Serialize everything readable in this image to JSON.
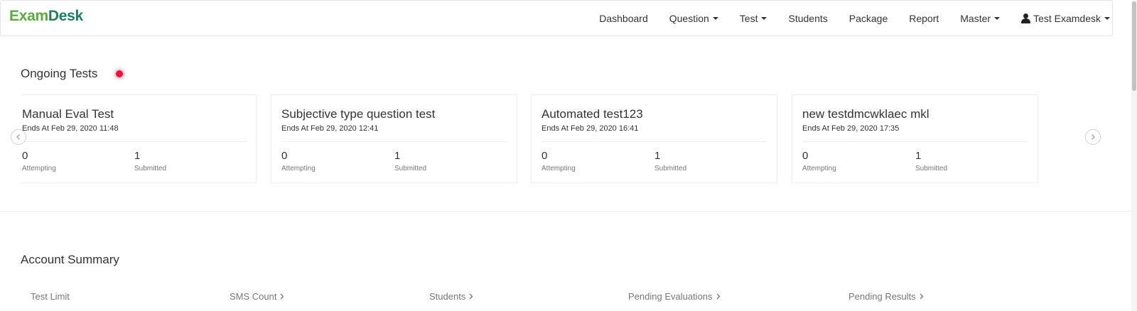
{
  "app": {
    "logo_exam": "Exam",
    "logo_desk": "Desk"
  },
  "nav": {
    "items": [
      {
        "label": "Dashboard",
        "dropdown": false
      },
      {
        "label": "Question",
        "dropdown": true
      },
      {
        "label": "Test",
        "dropdown": true
      },
      {
        "label": "Students",
        "dropdown": false
      },
      {
        "label": "Package",
        "dropdown": false
      },
      {
        "label": "Report",
        "dropdown": false
      },
      {
        "label": "Master",
        "dropdown": true
      }
    ],
    "user_label": "Test Examdesk"
  },
  "ongoing": {
    "title": "Ongoing Tests",
    "live_color": "#e8173d",
    "tests": [
      {
        "name": "Manual Eval Test",
        "ends": "Ends At Feb 29, 2020 11:48",
        "attempting": "0",
        "attempting_label": "Attempting",
        "submitted": "1",
        "submitted_label": "Submitted"
      },
      {
        "name": "Subjective type question test",
        "ends": "Ends At Feb 29, 2020 12:41",
        "attempting": "0",
        "attempting_label": "Attempting",
        "submitted": "1",
        "submitted_label": "Submitted"
      },
      {
        "name": "Automated test123",
        "ends": "Ends At Feb 29, 2020 16:41",
        "attempting": "0",
        "attempting_label": "Attempting",
        "submitted": "1",
        "submitted_label": "Submitted"
      },
      {
        "name": "new testdmcwklaec mkl",
        "ends": "Ends At Feb 29, 2020 17:35",
        "attempting": "0",
        "attempting_label": "Attempting",
        "submitted": "1",
        "submitted_label": "Submitted"
      }
    ]
  },
  "account": {
    "title": "Account Summary",
    "items": [
      {
        "label": "Test Limit",
        "link": false
      },
      {
        "label": "SMS Count",
        "link": true
      },
      {
        "label": "Students",
        "link": true
      },
      {
        "label": "Pending Evaluations",
        "link": true
      },
      {
        "label": "Pending Results",
        "link": true
      }
    ]
  },
  "colors": {
    "logo_green": "#5cab3c",
    "logo_dark_green": "#1e7e5d"
  }
}
